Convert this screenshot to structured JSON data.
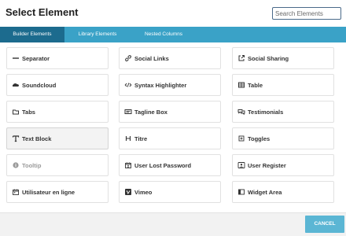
{
  "dialog": {
    "title": "Select Element",
    "search": {
      "placeholder": "Search Elements",
      "value": ""
    }
  },
  "tabs": [
    {
      "label": "Builder Elements",
      "active": true
    },
    {
      "label": "Library Elements",
      "active": false
    },
    {
      "label": "Nested Columns",
      "active": false
    }
  ],
  "elements": [
    {
      "label": "Separator",
      "icon": "separator-icon"
    },
    {
      "label": "Social Links",
      "icon": "link-icon"
    },
    {
      "label": "Social Sharing",
      "icon": "external-share-icon"
    },
    {
      "label": "Soundcloud",
      "icon": "soundcloud-icon"
    },
    {
      "label": "Syntax Highlighter",
      "icon": "code-icon"
    },
    {
      "label": "Table",
      "icon": "table-icon"
    },
    {
      "label": "Tabs",
      "icon": "folder-tabs-icon"
    },
    {
      "label": "Tagline Box",
      "icon": "tagline-box-icon"
    },
    {
      "label": "Testimonials",
      "icon": "speech-bubbles-icon"
    },
    {
      "label": "Text Block",
      "icon": "text-T-icon",
      "hovered": true
    },
    {
      "label": "Titre",
      "icon": "heading-H-icon"
    },
    {
      "label": "Toggles",
      "icon": "toggles-plus-icon"
    },
    {
      "label": "Tooltip",
      "icon": "info-circle-icon",
      "disabled": true
    },
    {
      "label": "User Lost Password",
      "icon": "calendar-user-icon"
    },
    {
      "label": "User Register",
      "icon": "user-register-icon"
    },
    {
      "label": "Utilisateur en ligne",
      "icon": "calendar-icon"
    },
    {
      "label": "Vimeo",
      "icon": "vimeo-icon"
    },
    {
      "label": "Widget Area",
      "icon": "widget-area-icon"
    }
  ],
  "footer": {
    "cancel_label": "CANCEL"
  },
  "colors": {
    "tab_bar": "#3aa2c7",
    "tab_active": "#1c6b8e",
    "cancel_button": "#5bb6d4",
    "search_border": "#4a6a8a"
  }
}
